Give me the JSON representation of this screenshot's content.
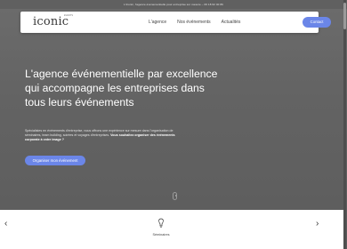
{
  "topbar": {
    "text": "L'Iconic, l'agence événementielle pour entreprise sur mesure – 06 18 62 40 86"
  },
  "navbar": {
    "logo": "iconic",
    "logo_sup": "EVENTS",
    "links": [
      "L'agence",
      "Nos événements",
      "Actualités"
    ],
    "contact": "Contact"
  },
  "hero": {
    "headline": "L'agence événementielle par excellence qui accompagne les entreprises dans tous leurs événements",
    "subtext_plain": "Spécialistes en événements d'entreprise, nous offrons une expérience sur mesure dans l'organisation de séminaires, team building, soirées et voyages d'entreprises.",
    "subtext_bold": "Vous souhaitez organiser des événements corporate à votre image ?",
    "cta": "Organiser mon événement"
  },
  "carousel": {
    "prev": "‹",
    "next": "›",
    "current_item": "Séminaires"
  },
  "colors": {
    "accent": "#6b86e8",
    "hero_bg": "#636363"
  }
}
